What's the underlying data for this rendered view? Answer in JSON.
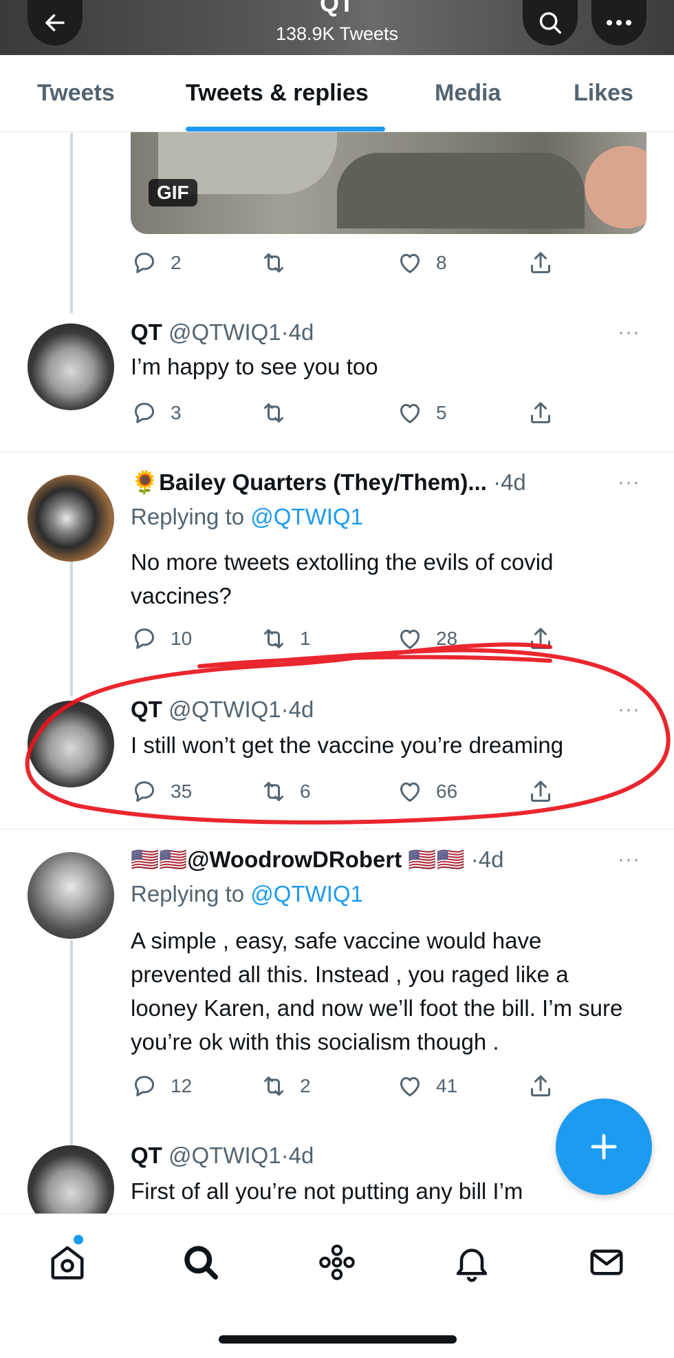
{
  "header": {
    "title": "QT",
    "subtitle": "138.9K Tweets"
  },
  "tabs": [
    {
      "label": "Tweets"
    },
    {
      "label": "Tweets & replies",
      "active": true
    },
    {
      "label": "Media"
    },
    {
      "label": "Likes"
    }
  ],
  "gif": {
    "badge": "GIF"
  },
  "tweets": [
    {
      "reply_count": "2",
      "retweet_count": "",
      "like_count": "8"
    },
    {
      "name": "QT",
      "handle": "@QTWIQ1",
      "sep": "·",
      "time": "4d",
      "text": "I’m happy to see you too",
      "reply_count": "3",
      "retweet_count": "",
      "like_count": "5"
    },
    {
      "name": "🌻Bailey Quarters (They/Them)...",
      "sep": "·",
      "time": "4d",
      "replying_prefix": "Replying to ",
      "replying_handle": "@QTWIQ1",
      "text": "No more tweets extolling the evils of covid vaccines?",
      "reply_count": "10",
      "retweet_count": "1",
      "like_count": "28"
    },
    {
      "name": "QT",
      "handle": "@QTWIQ1",
      "sep": "·",
      "time": "4d",
      "text": "I still won’t get the vaccine you’re dreaming",
      "reply_count": "35",
      "retweet_count": "6",
      "like_count": "66"
    },
    {
      "name_prefix": "🇺🇸🇺🇸",
      "name": "@WoodrowDRobert",
      "name_suffix": "🇺🇸🇺🇸",
      "sep": "·",
      "time": "4d",
      "replying_prefix": "Replying to ",
      "replying_handle": "@QTWIQ1",
      "text": "A simple , easy, safe vaccine would have prevented all this. Instead , you raged like a looney Karen, and now we’ll foot the bill. I’m sure you’re ok with this socialism though .",
      "reply_count": "12",
      "retweet_count": "2",
      "like_count": "41"
    },
    {
      "name": "QT",
      "handle": "@QTWIQ1",
      "sep": "·",
      "time": "4d",
      "text": "First of all you’re not putting any bill I’m"
    }
  ],
  "more_glyph": "···",
  "colors": {
    "accent": "#1d9bf0",
    "annotation": "#e8141c",
    "text": "#0f1419",
    "muted": "#536471"
  },
  "icons": [
    "back-arrow-icon",
    "search-icon",
    "more-icon",
    "reply-icon",
    "retweet-icon",
    "like-icon",
    "share-icon",
    "compose-plus-icon",
    "home-icon",
    "explore-icon",
    "spaces-icon",
    "notifications-icon",
    "messages-icon"
  ]
}
